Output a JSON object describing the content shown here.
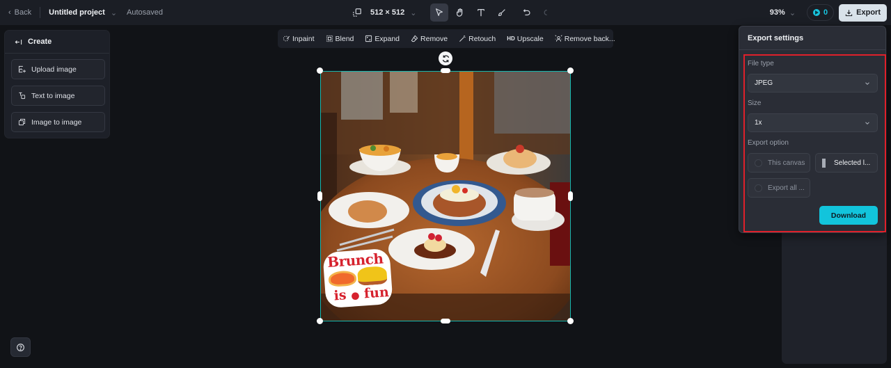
{
  "topbar": {
    "back_label": "Back",
    "project_name": "Untitled project",
    "save_status": "Autosaved",
    "canvas_size": "512 × 512",
    "zoom_level": "93%",
    "credits": "0",
    "export_label": "Export"
  },
  "create_panel": {
    "title": "Create",
    "items": [
      {
        "label": "Upload image",
        "icon": "upload-image-icon"
      },
      {
        "label": "Text to image",
        "icon": "text-to-image-icon"
      },
      {
        "label": "Image to image",
        "icon": "image-to-image-icon"
      }
    ]
  },
  "tools": [
    {
      "label": "Inpaint",
      "icon": "inpaint-icon"
    },
    {
      "label": "Blend",
      "icon": "blend-icon"
    },
    {
      "label": "Expand",
      "icon": "expand-icon"
    },
    {
      "label": "Remove",
      "icon": "eraser-icon"
    },
    {
      "label": "Retouch",
      "icon": "magic-wand-icon"
    },
    {
      "label": "Upscale",
      "badge": "HD",
      "icon": "hd-icon"
    },
    {
      "label": "Remove back...",
      "icon": "remove-background-icon"
    }
  ],
  "canvas": {
    "sticker_line1": "Brunch",
    "sticker_line2": "is",
    "sticker_line3": "fun",
    "selection_color": "#14b8b0"
  },
  "export_settings": {
    "title": "Export settings",
    "file_type_label": "File type",
    "file_type_value": "JPEG",
    "size_label": "Size",
    "size_value": "1x",
    "export_option_label": "Export option",
    "options": [
      {
        "label": "This canvas",
        "selected": false
      },
      {
        "label": "Selected l...",
        "selected": true
      },
      {
        "label": "Export all ...",
        "selected": false
      }
    ],
    "download_label": "Download",
    "accent_color": "#12c4dc",
    "highlight_color": "#e0202a"
  }
}
